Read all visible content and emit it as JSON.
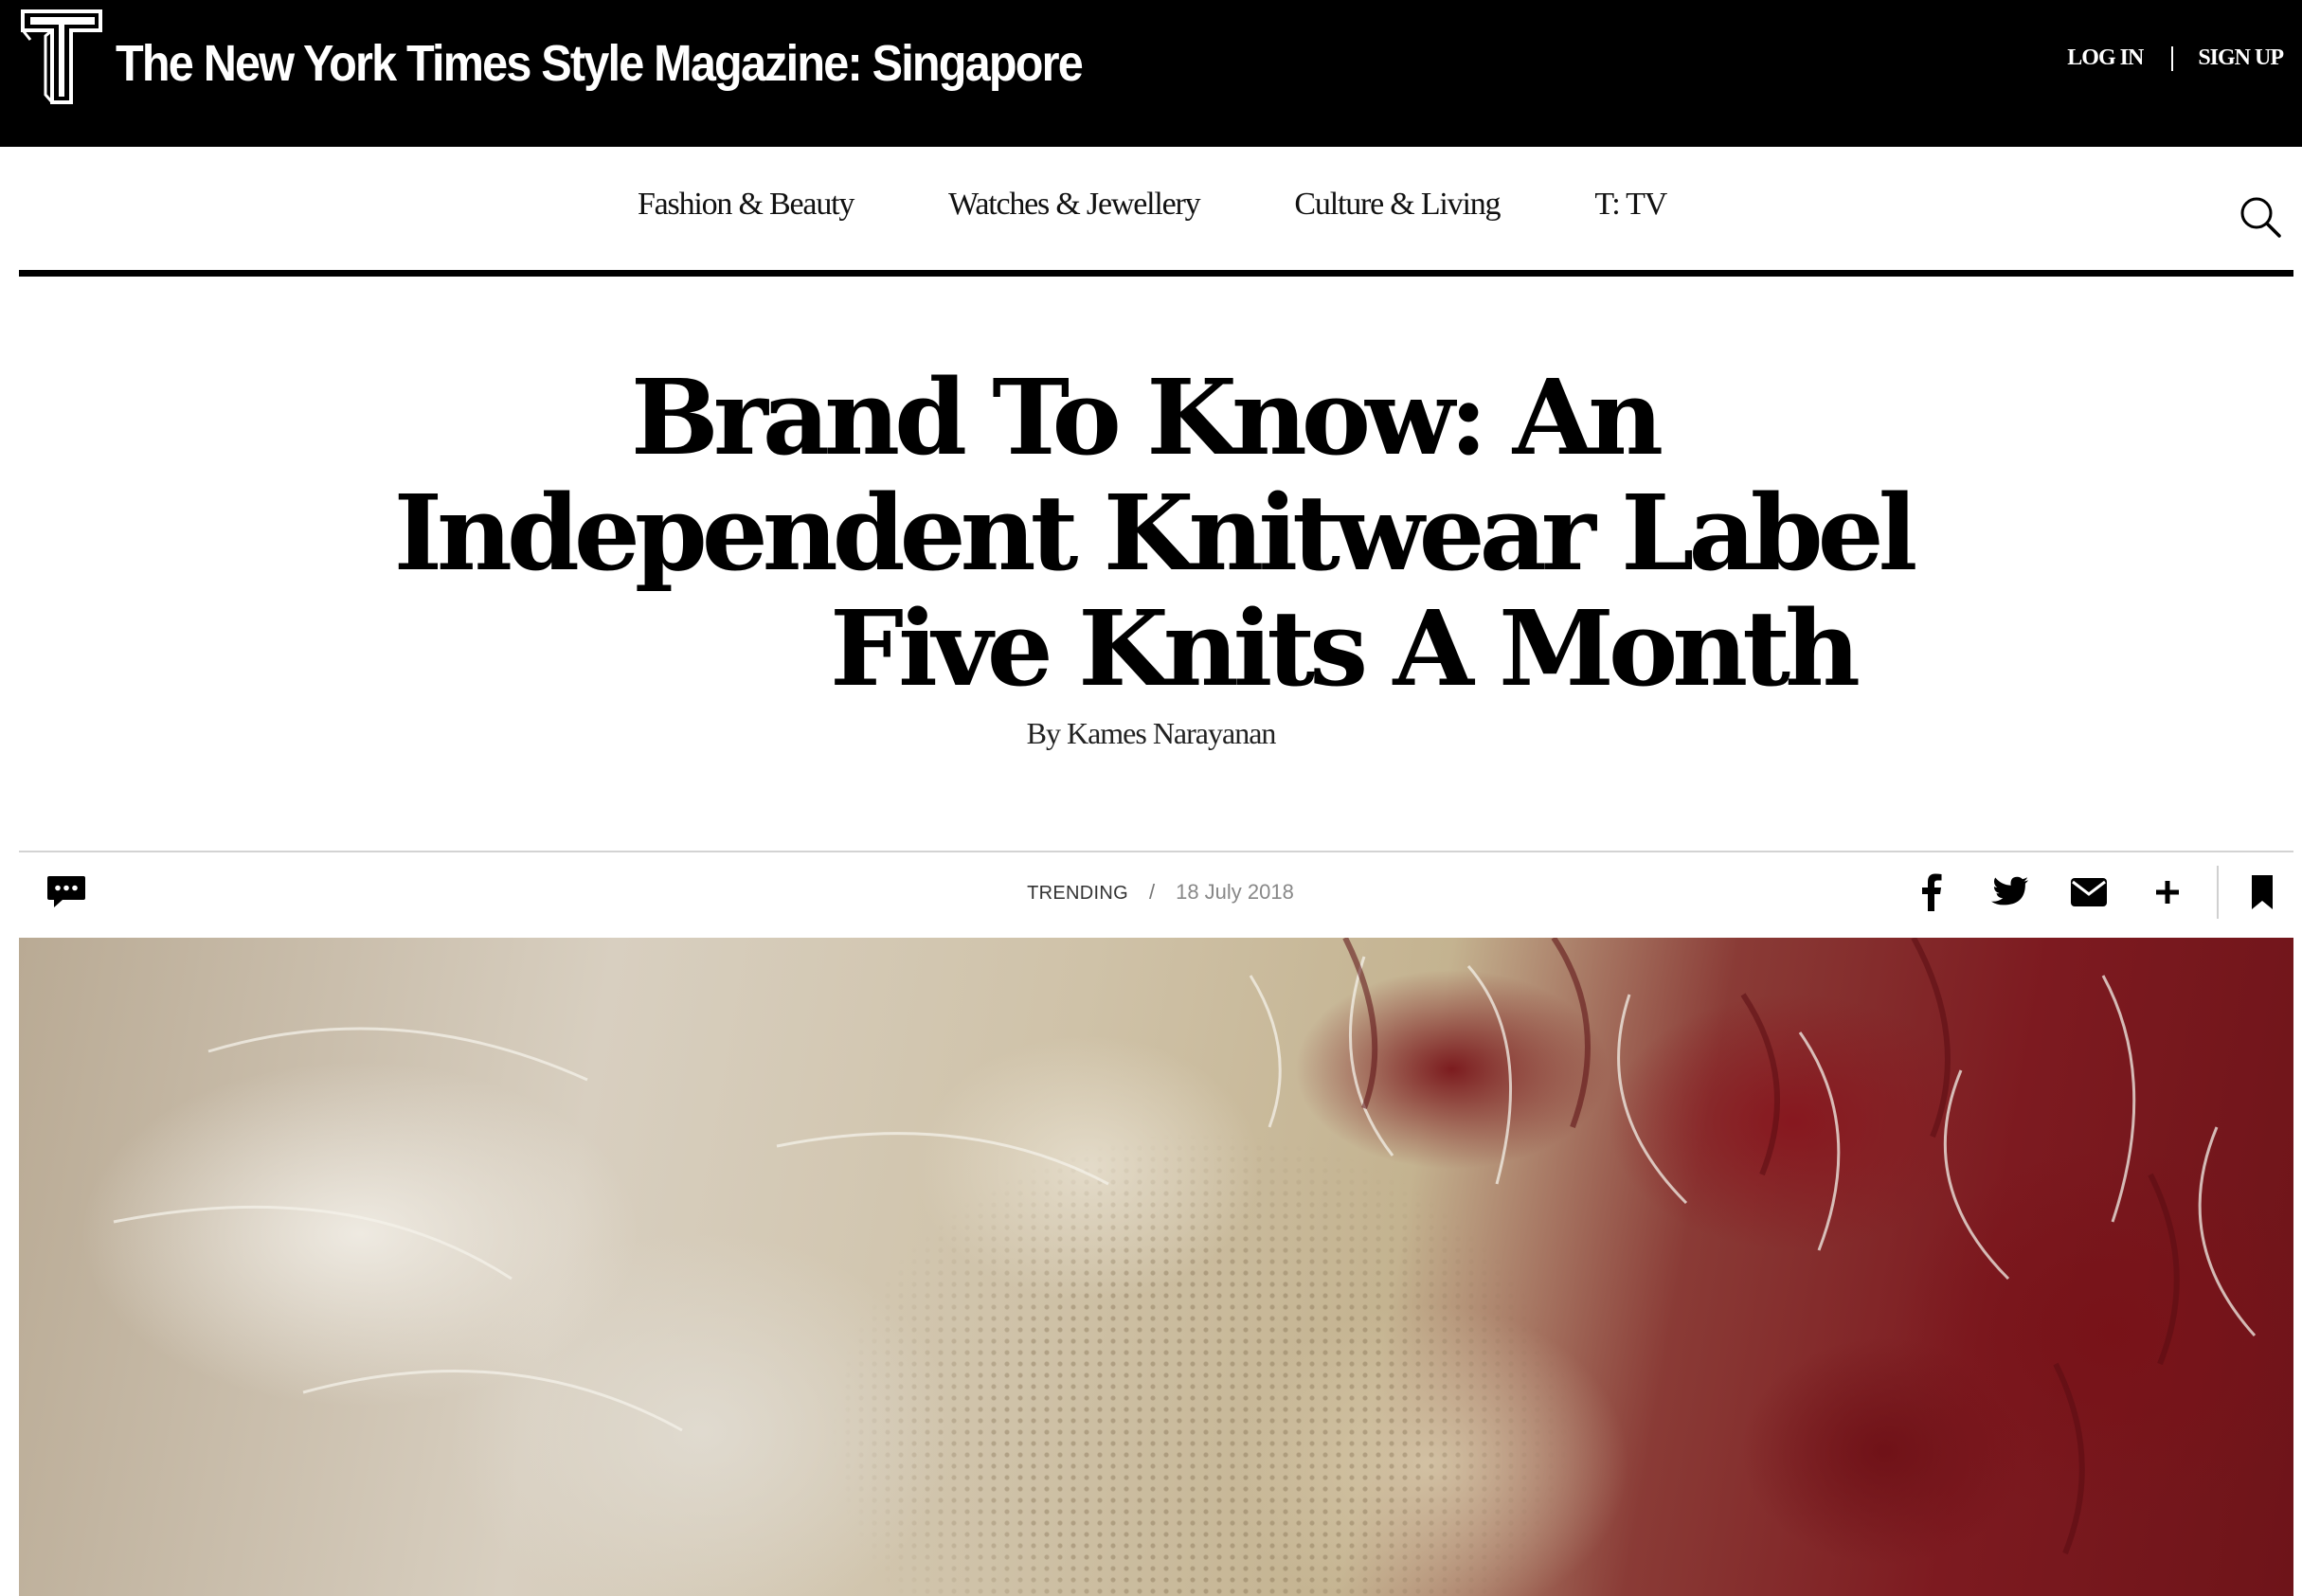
{
  "header": {
    "logo_icon": "t-magazine-logo-icon",
    "site_title": "The New York Times Style Magazine: Singapore",
    "login_label": "LOG IN",
    "signup_label": "SIGN UP"
  },
  "nav": {
    "items": [
      {
        "label": "Fashion & Beauty"
      },
      {
        "label": "Watches & Jewellery"
      },
      {
        "label": "Culture & Living"
      },
      {
        "label": "T: TV"
      }
    ],
    "search_icon": "search-icon"
  },
  "article": {
    "title_lines": [
      "Brand To Know: An",
      "Independent Knitwear Label",
      "Five Knits A Month"
    ],
    "byline": "By Kames Narayanan",
    "kicker": "TRENDING",
    "separator": "/",
    "date": "18 July 2018",
    "hero_image": "close-up-of-cream-and-red-mohair-knitwear"
  },
  "toolbar": {
    "icons": [
      "comment-icon",
      "facebook-icon",
      "twitter-icon",
      "email-icon",
      "plus-icon",
      "bookmark-icon"
    ]
  },
  "colors": {
    "topbar_bg": "#000000",
    "text": "#000000",
    "rule_light": "#d3d3d3",
    "knit_red": "#7d1a20",
    "knit_cream": "#d8cfc0"
  }
}
